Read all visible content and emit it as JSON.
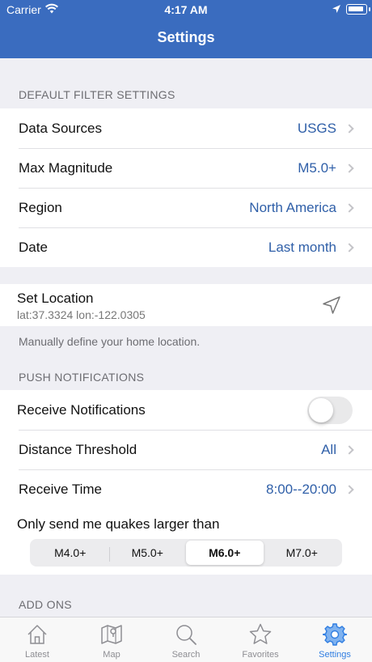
{
  "status_bar": {
    "carrier": "Carrier",
    "time": "4:17 AM"
  },
  "nav": {
    "title": "Settings"
  },
  "default_filter": {
    "header": "DEFAULT FILTER SETTINGS",
    "rows": [
      {
        "label": "Data Sources",
        "value": "USGS"
      },
      {
        "label": "Max Magnitude",
        "value": "M5.0+"
      },
      {
        "label": "Region",
        "value": "North America"
      },
      {
        "label": "Date",
        "value": "Last month"
      }
    ]
  },
  "location": {
    "title": "Set Location",
    "coords": "lat:37.3324 lon:-122.0305",
    "footnote": "Manually define your home location."
  },
  "push": {
    "header": "PUSH NOTIFICATIONS",
    "receive_label": "Receive Notifications",
    "receive_enabled": false,
    "distance_label": "Distance Threshold",
    "distance_value": "All",
    "time_label": "Receive Time",
    "time_value": "8:00--20:00",
    "quake_title": "Only send me quakes larger than",
    "quake_options": [
      "M4.0+",
      "M5.0+",
      "M6.0+",
      "M7.0+"
    ],
    "quake_selected": "M6.0+"
  },
  "addons": {
    "header": "ADD ONS"
  },
  "tabs": [
    {
      "label": "Latest",
      "icon": "house-icon"
    },
    {
      "label": "Map",
      "icon": "map-icon"
    },
    {
      "label": "Search",
      "icon": "search-icon"
    },
    {
      "label": "Favorites",
      "icon": "star-icon"
    },
    {
      "label": "Settings",
      "icon": "gear-icon",
      "active": true
    }
  ],
  "colors": {
    "header": "#3a6cbf",
    "value": "#2f5fa8",
    "active_tab": "#2f7de1"
  }
}
